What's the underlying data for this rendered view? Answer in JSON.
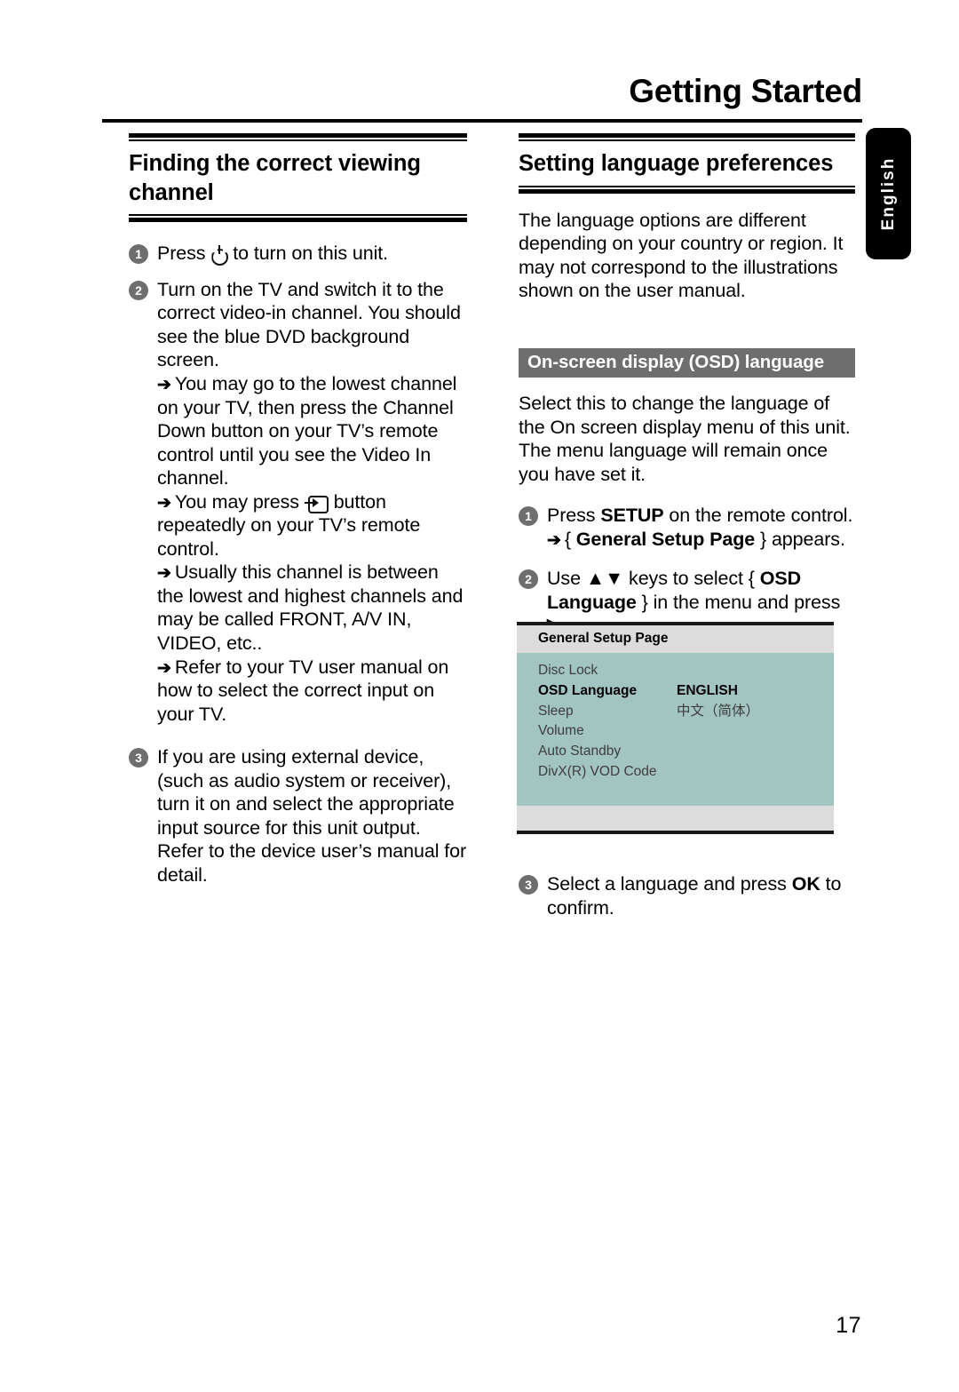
{
  "running_head": "Getting Started",
  "side_tab": {
    "label": "English"
  },
  "page_number": "17",
  "colors": {
    "osd_panel": "#a3c5c1",
    "osd_chrome": "#dcdcdc",
    "subhead_bg": "#6e6e6e",
    "step_marker": "#6e6e6e"
  },
  "left_column": {
    "section_title": "Finding the correct viewing channel",
    "steps": [
      {
        "number": "1",
        "text_before_icon": "Press",
        "icon": "power-standby-icon",
        "text_after_icon": "to turn on this unit.",
        "subs": []
      },
      {
        "number": "2",
        "text": "Turn on the TV and switch it to the correct video-in channel. You should see the blue DVD background screen.",
        "subs": [
          {
            "arrow": "➔",
            "text": "You may go to the lowest channel on your TV, then press the Channel Down button on your TV’s remote control until you see the Video In channel."
          },
          {
            "arrow": "➔",
            "text_before_icon": "You may press",
            "icon": "av-input-icon",
            "text_after_icon": "button repeatedly on your TV’s remote control."
          },
          {
            "arrow": "➔",
            "text": "Usually this channel is between the lowest and highest channels and may be called FRONT, A/V IN, VIDEO, etc.."
          },
          {
            "arrow": "➔",
            "text": "Refer to your TV user manual on how to select the correct input on your TV."
          }
        ]
      },
      {
        "number": "3",
        "text": "If you are using external device, (such as audio system or receiver), turn it on and select the appropriate input source for this unit output. Refer to the device user’s manual for detail.",
        "subs": []
      }
    ]
  },
  "right_column": {
    "section_title": "Setting language preferences",
    "intro": "The language options are different depending on your country or region. It may not correspond to the illustrations shown on the user manual.",
    "subhead": "On-screen display (OSD) language",
    "description": "Select this to change the language of the On screen display menu of this unit. The menu language will remain once you have set it.",
    "steps": [
      {
        "number": "1",
        "text_parts": [
          "Press ",
          "SETUP",
          " on the remote control."
        ],
        "sub_arrow": "➔",
        "sub_parts": [
          "{ ",
          "General Setup Page",
          " } appears."
        ]
      },
      {
        "number": "2",
        "text_parts": [
          "Use ",
          "▲▼",
          " keys to select { ",
          "OSD Language",
          " } in the menu and press ",
          "▶",
          "."
        ]
      }
    ],
    "final_step": {
      "number": "3",
      "text_parts": [
        "Select a language and press ",
        "OK",
        " to confirm."
      ]
    }
  },
  "osd_screenshot": {
    "title": "General Setup Page",
    "rows": [
      {
        "label": "Disc Lock",
        "value": ""
      },
      {
        "label": "OSD Language",
        "value": "ENGLISH"
      },
      {
        "label": "Sleep",
        "value": "中文（简体）"
      },
      {
        "label": "Volume",
        "value": ""
      },
      {
        "label": "Auto Standby",
        "value": ""
      },
      {
        "label": "DivX(R) VOD Code",
        "value": ""
      }
    ]
  }
}
